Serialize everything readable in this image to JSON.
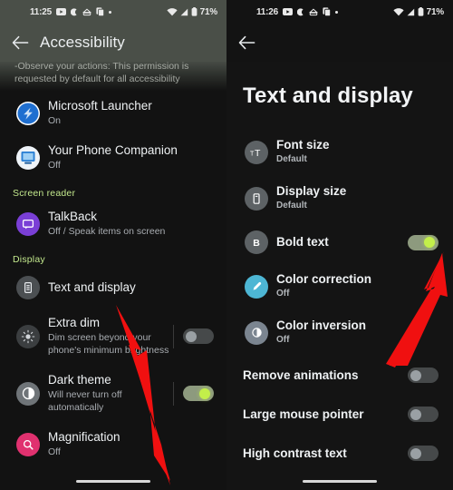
{
  "left_phone": {
    "status_bar": {
      "time": "11:25",
      "battery": "71%",
      "icons": [
        "youtube-icon",
        "moon-icon",
        "vpn-icon",
        "copy-icon",
        "dot-icon",
        "wifi-icon",
        "signal-icon",
        "battery-icon"
      ]
    },
    "app_bar": {
      "title": "Accessibility",
      "back": "back-arrow"
    },
    "partial_text": "-Observe your actions: This permission is requested by default for all accessibility",
    "items": [
      {
        "title": "Microsoft Launcher",
        "subtitle": "On",
        "icon": "microsoft-launcher-icon",
        "icon_color": "#1f6fd0",
        "toggle": null
      },
      {
        "title": "Your Phone Companion",
        "subtitle": "Off",
        "icon": "your-phone-companion-icon",
        "icon_color": "#e8eef5",
        "toggle": null
      }
    ],
    "section_screen_reader": "Screen reader",
    "screen_reader_items": [
      {
        "title": "TalkBack",
        "subtitle": "Off / Speak items on screen",
        "icon": "talkback-icon",
        "icon_color": "#7a3fd6",
        "toggle": null
      }
    ],
    "section_display": "Display",
    "display_items": [
      {
        "title": "Text and display",
        "subtitle": "",
        "icon": "text-and-display-icon",
        "icon_color": "#4a4a4a",
        "toggle": null
      },
      {
        "title": "Extra dim",
        "subtitle": "Dim screen beyond your phone's minimum brightness",
        "icon": "extra-dim-icon",
        "icon_color": "#3c3c3c",
        "toggle": "off"
      },
      {
        "title": "Dark theme",
        "subtitle": "Will never turn off automatically",
        "icon": "dark-theme-icon",
        "icon_color": "#6e7276",
        "toggle": "on"
      },
      {
        "title": "Magnification",
        "subtitle": "Off",
        "icon": "magnification-icon",
        "icon_color": "#e0316f",
        "toggle": null
      }
    ]
  },
  "right_phone": {
    "status_bar": {
      "time": "11:26",
      "battery": "71%"
    },
    "app_bar": {
      "back": "back-arrow"
    },
    "page_title": "Text and display",
    "items": [
      {
        "title": "Font size",
        "subtitle": "Default",
        "icon": "font-size-icon",
        "icon_color": "#5d6265",
        "toggle": null
      },
      {
        "title": "Display size",
        "subtitle": "Default",
        "icon": "display-size-icon",
        "icon_color": "#5d6265",
        "toggle": null
      },
      {
        "title": "Bold text",
        "subtitle": "",
        "icon": "bold-text-icon",
        "icon_color": "#5d6265",
        "toggle": "on"
      },
      {
        "title": "Color correction",
        "subtitle": "Off",
        "icon": "color-correction-icon",
        "icon_color": "#4db6d4",
        "toggle": null
      },
      {
        "title": "Color inversion",
        "subtitle": "Off",
        "icon": "color-inversion-icon",
        "icon_color": "#7b8590",
        "toggle": null
      }
    ],
    "plain_items": [
      {
        "title": "Remove animations",
        "toggle": "off"
      },
      {
        "title": "Large mouse pointer",
        "toggle": "off"
      },
      {
        "title": "High contrast text",
        "toggle": "off"
      }
    ]
  },
  "annotations": {
    "arrow_color": "#f01010",
    "arrow_left_target": "text-and-display-row",
    "arrow_right_target": "bold-text-toggle"
  }
}
